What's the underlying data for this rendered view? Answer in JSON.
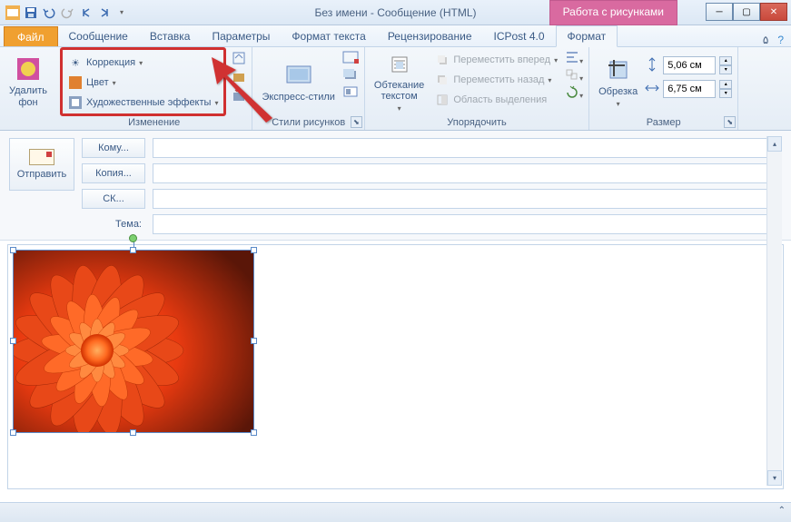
{
  "title": "Без имени  -  Сообщение (HTML)",
  "context_tab": "Работа с рисунками",
  "tabs": {
    "file": "Файл",
    "t1": "Сообщение",
    "t2": "Вставка",
    "t3": "Параметры",
    "t4": "Формат текста",
    "t5": "Рецензирование",
    "t6": "ICPost 4.0",
    "t7": "Формат"
  },
  "ribbon": {
    "remove_bg": "Удалить\nфон",
    "adjust": {
      "corrections": "Коррекция",
      "color": "Цвет",
      "artistic": "Художественные эффекты",
      "label": "Изменение"
    },
    "styles": {
      "express": "Экспресс-стили",
      "label": "Стили рисунков"
    },
    "arrange": {
      "wrap": "Обтекание\nтекстом",
      "fwd": "Переместить вперед",
      "back": "Переместить назад",
      "select_pane": "Область выделения",
      "label": "Упорядочить"
    },
    "size": {
      "crop": "Обрезка",
      "height": "5,06 см",
      "width": "6,75 см",
      "label": "Размер"
    }
  },
  "msg": {
    "send": "Отправить",
    "to": "Кому...",
    "cc": "Копия...",
    "bcc": "СК...",
    "subject_label": "Тема:"
  }
}
